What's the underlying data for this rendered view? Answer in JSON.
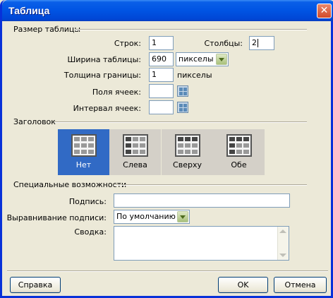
{
  "window": {
    "title": "Таблица"
  },
  "table_size": {
    "section": "Размер таблицы",
    "rows_label": "Строк:",
    "rows_value": "1",
    "cols_label": "Столбцы:",
    "cols_value": "2",
    "width_label": "Ширина таблицы:",
    "width_value": "690",
    "width_unit": "пикселы",
    "border_label": "Толщина границы:",
    "border_value": "1",
    "border_unit": "пикселы",
    "padding_label": "Поля ячеек:",
    "padding_value": "",
    "spacing_label": "Интервал ячеек:",
    "spacing_value": ""
  },
  "header": {
    "section": "Заголовок",
    "options": [
      "Нет",
      "Слева",
      "Сверху",
      "Обе"
    ],
    "selected": "Нет"
  },
  "accessibility": {
    "section": "Специальные возможности",
    "caption_label": "Подпись:",
    "caption_value": "",
    "align_label": "Выравнивание подписи:",
    "align_value": "По умолчанию",
    "summary_label": "Сводка:",
    "summary_value": ""
  },
  "buttons": {
    "help": "Справка",
    "ok": "OK",
    "cancel": "Отмена"
  },
  "icons": {
    "close": "close-icon",
    "dropdown": "chevron-down-icon",
    "grid": "grid-icon"
  }
}
